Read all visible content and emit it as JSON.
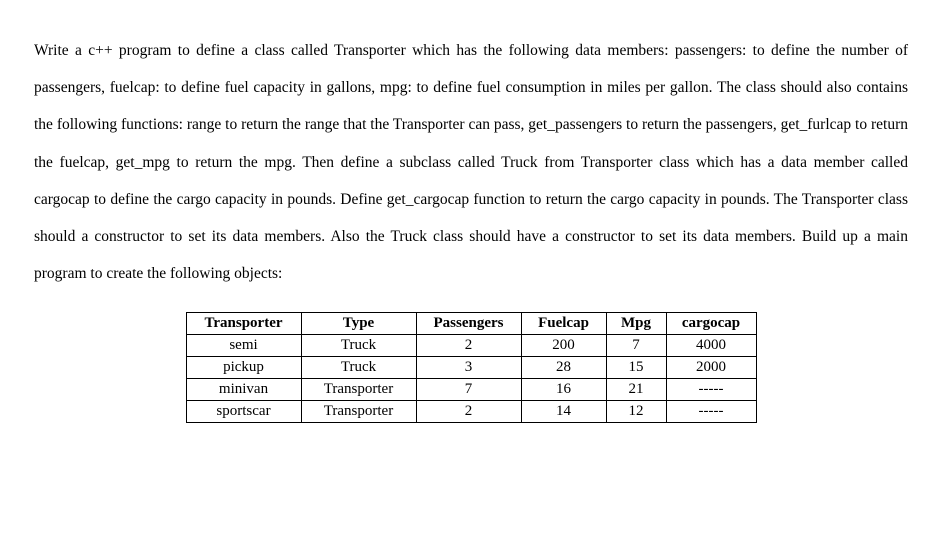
{
  "paragraph": "Write a c++ program to define a class called Transporter which has the following data members: passengers: to define the number of passengers, fuelcap: to define fuel capacity in gallons, mpg: to define fuel consumption in miles per gallon. The class should also contains the following functions: range to return the range that the Transporter can pass, get_passengers to return the passengers, get_furlcap to return the fuelcap, get_mpg to return the mpg. Then define a subclass called Truck from Transporter class which has a data member called cargocap to define the cargo capacity in pounds. Define get_cargocap function to return the cargo capacity in pounds.  The Transporter class should a constructor to set its data members. Also the Truck class should have a constructor to set its data members. Build up a main program to create the following objects:",
  "table": {
    "headers": [
      "Transporter",
      "Type",
      "Passengers",
      "Fuelcap",
      "Mpg",
      "cargocap"
    ],
    "rows": [
      [
        "semi",
        "Truck",
        "2",
        "200",
        "7",
        "4000"
      ],
      [
        "pickup",
        "Truck",
        "3",
        "28",
        "15",
        "2000"
      ],
      [
        "minivan",
        "Transporter",
        "7",
        "16",
        "21",
        "-----"
      ],
      [
        "sportscar",
        "Transporter",
        "2",
        "14",
        "12",
        "-----"
      ]
    ]
  }
}
